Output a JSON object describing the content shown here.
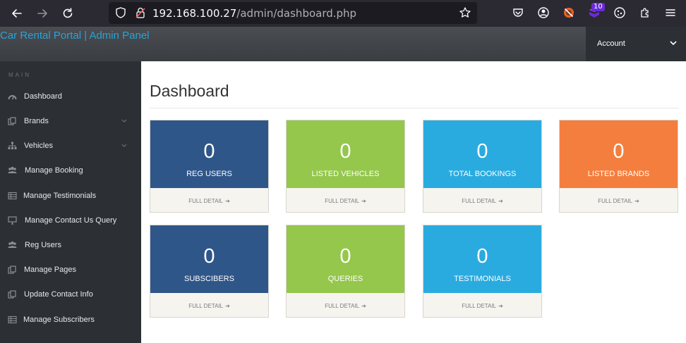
{
  "browser": {
    "url_host": "192.168.100.27",
    "url_path": "/admin/dashboard.php",
    "extension_badge": "10"
  },
  "header": {
    "brand": "Car Rental Portal | Admin Panel",
    "account_label": "Account"
  },
  "sidebar": {
    "heading": "MAIN",
    "items": [
      {
        "label": "Dashboard",
        "icon": "dashboard-icon"
      },
      {
        "label": "Brands",
        "icon": "files-icon",
        "has_caret": true
      },
      {
        "label": "Vehicles",
        "icon": "sitemap-icon",
        "has_caret": true
      },
      {
        "label": "Manage Booking",
        "icon": "users-icon"
      },
      {
        "label": "Manage Testimonials",
        "icon": "table-icon"
      },
      {
        "label": "Manage Contact Us Query",
        "icon": "desktop-icon"
      },
      {
        "label": "Reg Users",
        "icon": "users-icon"
      },
      {
        "label": "Manage Pages",
        "icon": "files-icon"
      },
      {
        "label": "Update Contact Info",
        "icon": "files-icon"
      },
      {
        "label": "Manage Subscribers",
        "icon": "table-icon"
      }
    ]
  },
  "main": {
    "title": "Dashboard",
    "cards": [
      {
        "value": "0",
        "label": "REG USERS",
        "link": "FULL DETAIL",
        "color": "#2f5688"
      },
      {
        "value": "0",
        "label": "LISTED VEHICLES",
        "link": "FULL DETAIL",
        "color": "#94c74b"
      },
      {
        "value": "0",
        "label": "TOTAL BOOKINGS",
        "link": "FULL DETAIL",
        "color": "#2aabe0"
      },
      {
        "value": "0",
        "label": "LISTED BRANDS",
        "link": "FULL DETAIL",
        "color": "#f47e3e"
      },
      {
        "value": "0",
        "label": "SUBSCIBERS",
        "link": "FULL DETAIL",
        "color": "#2f5688"
      },
      {
        "value": "0",
        "label": "QUERIES",
        "link": "FULL DETAIL",
        "color": "#94c74b"
      },
      {
        "value": "0",
        "label": "TESTIMONIALS",
        "link": "FULL DETAIL",
        "color": "#2aabe0"
      }
    ]
  }
}
